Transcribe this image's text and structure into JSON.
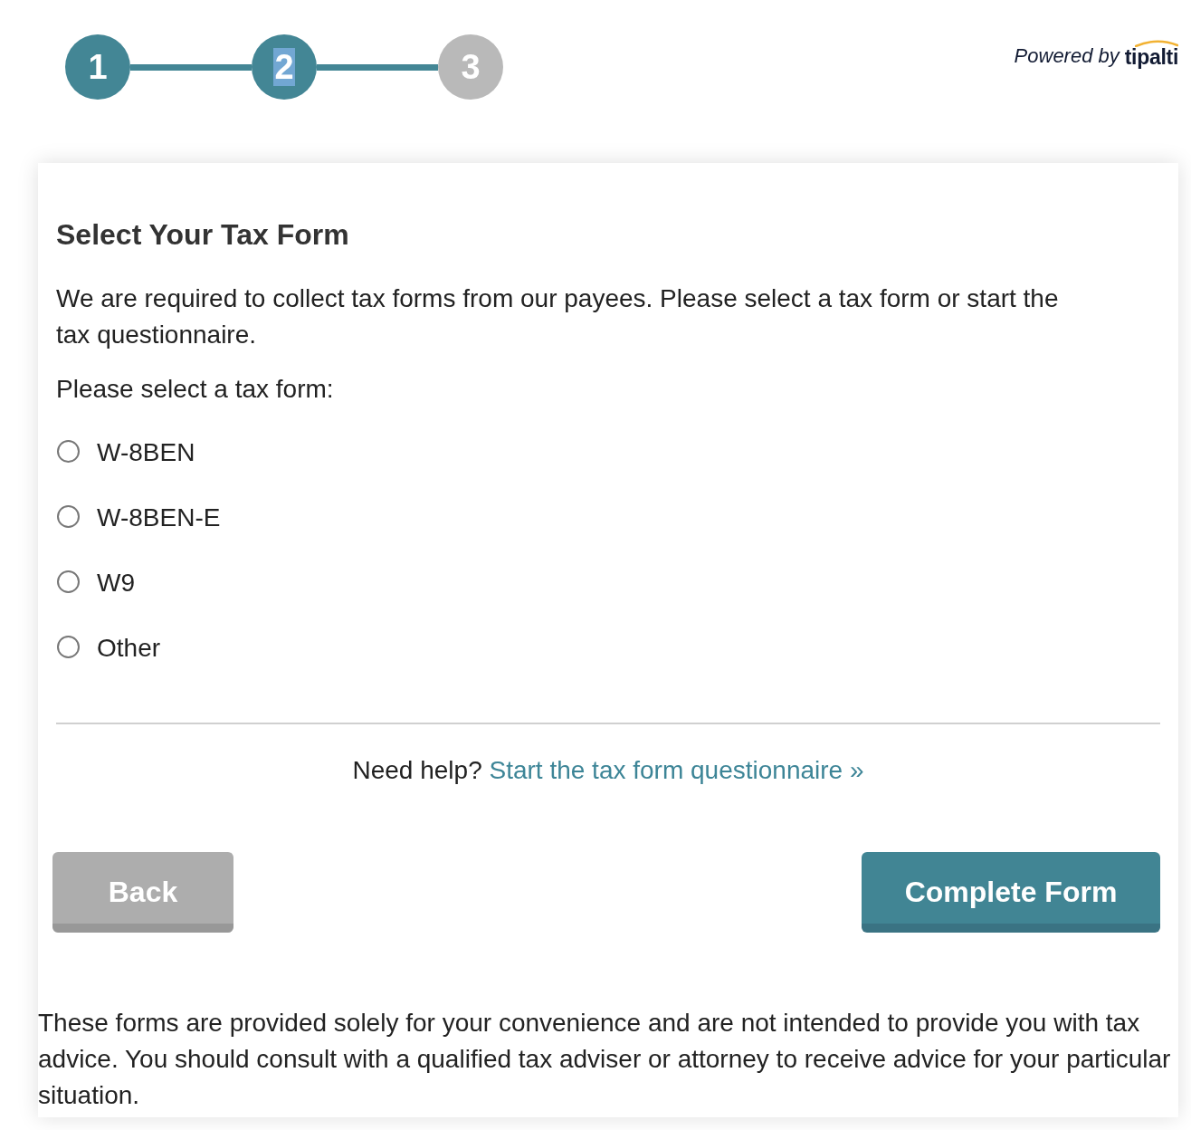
{
  "steps": [
    {
      "number": "1",
      "active": true,
      "text_highlighted": false
    },
    {
      "number": "2",
      "active": true,
      "text_highlighted": true
    },
    {
      "number": "3",
      "active": false,
      "text_highlighted": false
    }
  ],
  "branding": {
    "prefix": "Powered by",
    "logo_text": "tipalti"
  },
  "form": {
    "title": "Select Your Tax Form",
    "intro": "We are required to collect tax forms from our payees. Please select a tax form or start the tax questionnaire.",
    "prompt": "Please select a tax form:",
    "options": [
      {
        "label": "W-8BEN",
        "selected": false
      },
      {
        "label": "W-8BEN-E",
        "selected": false
      },
      {
        "label": "W9",
        "selected": false
      },
      {
        "label": "Other",
        "selected": false
      }
    ],
    "help": {
      "text": "Need help?",
      "link": "Start the tax form questionnaire »"
    }
  },
  "buttons": [
    {
      "label": "Back",
      "kind": "secondary"
    },
    {
      "label": "Complete Form",
      "kind": "primary"
    }
  ],
  "disclaimer": "These forms are provided solely for your convenience and are not intended to provide you with tax advice. You should consult with a qualified tax adviser or attorney to receive advice for your particular situation."
}
